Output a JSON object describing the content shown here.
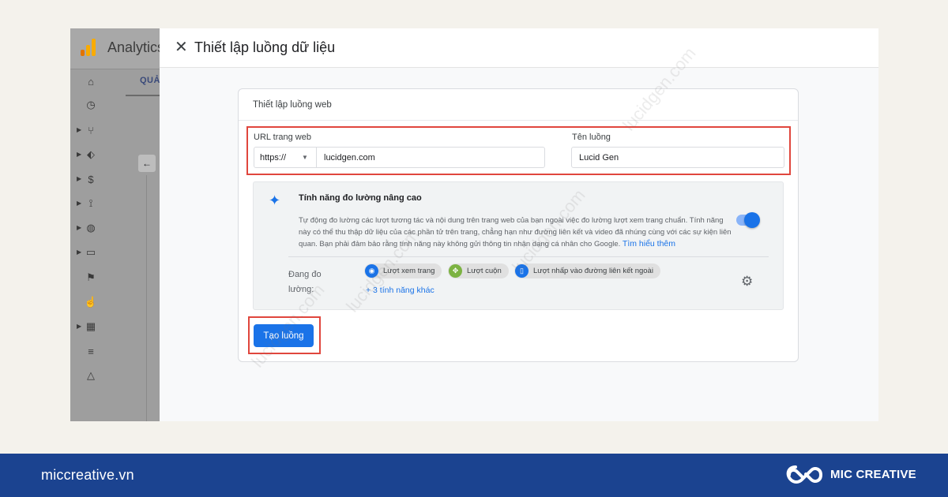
{
  "analytics": {
    "app_title": "Analytics",
    "tab_label": "QUẢ",
    "logo_colors": [
      "#e37400",
      "#f9ab00",
      "#f9ab00"
    ]
  },
  "dialog": {
    "title": "Thiết lập luồng dữ liệu",
    "close_icon": "close-icon",
    "card_title": "Thiết lập luồng web",
    "url_label": "URL trang web",
    "protocol": "https://",
    "url_value": "lucidgen.com",
    "stream_name_label": "Tên luồng",
    "stream_name_value": "Lucid Gen",
    "enhanced": {
      "title": "Tính năng đo lường nâng cao",
      "description": "Tự động đo lường các lượt tương tác và nội dung trên trang web của bạn ngoài việc đo lường lượt xem trang chuẩn. Tính năng này có thể thu thập dữ liệu của các phần tử trên trang, chẳng hạn như đường liên kết và video đã nhúng cùng với các sự kiện liên quan. Bạn phải đảm bảo rằng tính năng này không gửi thông tin nhận dạng cá nhân cho Google.",
      "learn_more": "Tìm hiểu thêm",
      "toggle_on": true,
      "measuring_label": "Đang đo lường:",
      "chips": [
        {
          "label": "Lượt xem trang",
          "icon": "eye-icon",
          "color": "#1a73e8"
        },
        {
          "label": "Lượt cuộn",
          "icon": "scroll-icon",
          "color": "#7cb342"
        },
        {
          "label": "Lượt nhấp vào đường liên kết ngoài",
          "icon": "mouse-icon",
          "color": "#1a73e8"
        }
      ],
      "more_features": "+ 3 tính năng khác"
    },
    "create_button": "Tạo luồng"
  },
  "watermark": "lucidgen.com",
  "footer": {
    "site": "miccreative.vn",
    "brand": "MIC CREATIVE"
  }
}
